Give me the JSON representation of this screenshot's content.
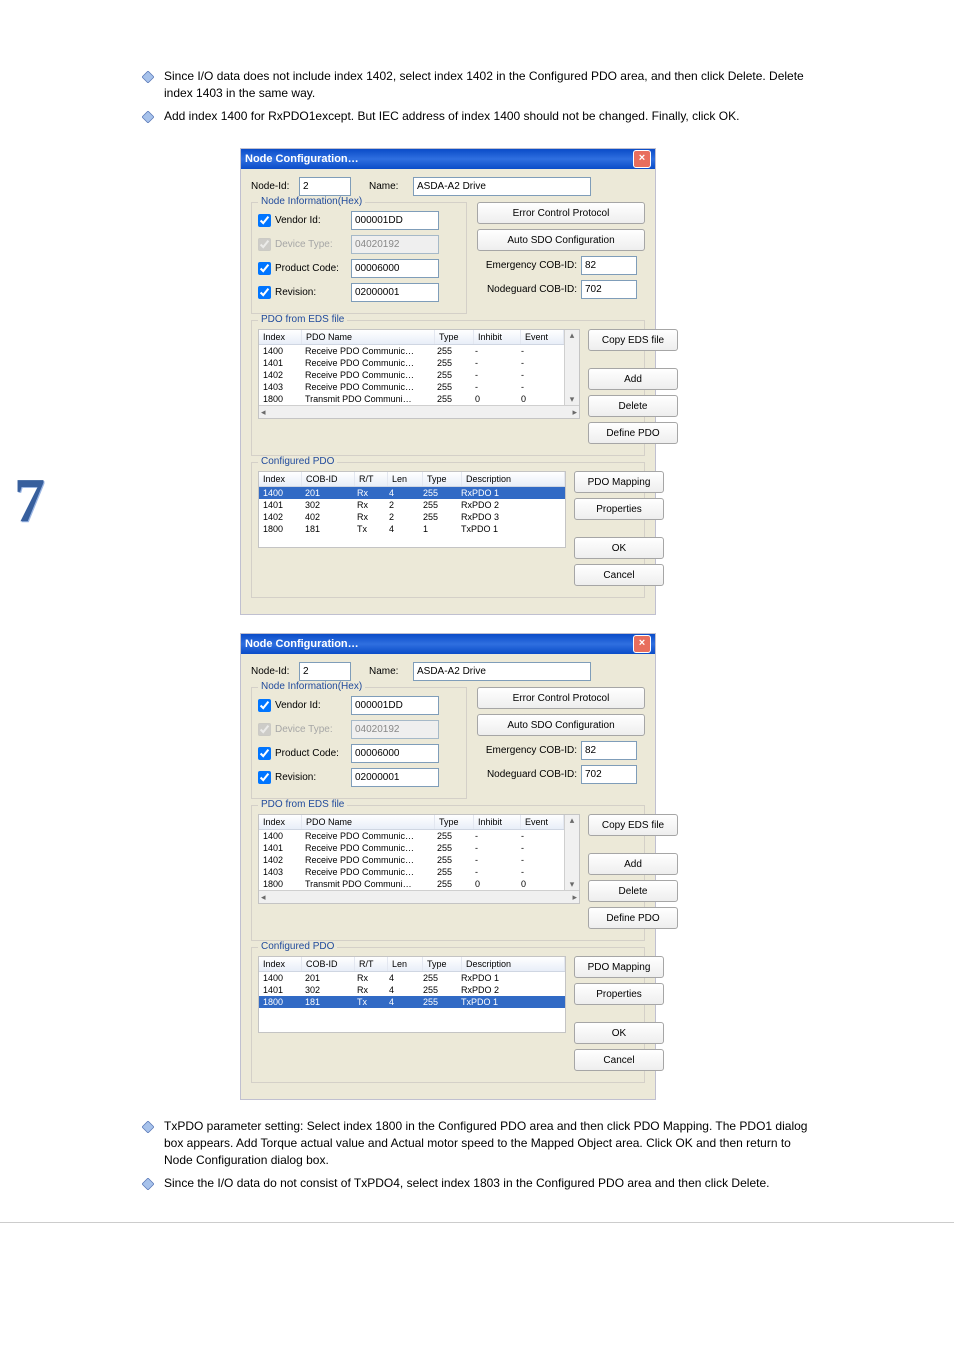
{
  "bullets": {
    "b1": "Since I/O data does not include index 1402, select index 1402 in the Configured PDO area, and then click Delete. Delete index 1403 in the same way.",
    "b2": "Add index 1400 for RxPDO1except. But IEC address of index 1400 should not be changed. Finally, click OK.",
    "b3": "TxPDO parameter setting: Select index 1800 in the Configured PDO area and then click PDO Mapping. The PDO1 dialog box appears. Add Torque actual value and Actual motor speed to the Mapped Object area. Click OK and then return to Node Configuration dialog box.",
    "b4": "Since the I/O data do not consist of TxPDO4, select index 1803 in the Configured PDO area and then click Delete."
  },
  "dlg1": {
    "title": "Node Configuration…",
    "nodeIdLabel": "Node-Id:",
    "nodeId": "2",
    "nameLabel": "Name:",
    "name": "ASDA-A2 Drive",
    "nodeInfoTitle": "Node Information(Hex)",
    "vendorLabel": "Vendor Id:",
    "vendorVal": "000001DD",
    "deviceTypeLabel": "Device Type:",
    "deviceTypeVal": "04020192",
    "productCodeLabel": "Product Code:",
    "productCodeVal": "00006000",
    "revisionLabel": "Revision:",
    "revisionVal": "02000001",
    "errBtn": "Error Control Protocol",
    "autoBtn": "Auto SDO Configuration",
    "emCobLabel": "Emergency COB-ID:",
    "emCobVal": "82",
    "ngCobLabel": "Nodeguard COB-ID:",
    "ngCobVal": "702",
    "pdoFromTitle": "PDO from EDS file",
    "pdoCols": [
      "Index",
      "PDO Name",
      "Type",
      "Inhibit",
      "Event"
    ],
    "pdoRows": [
      {
        "idx": "1400",
        "name": "Receive PDO Communic…",
        "type": "255",
        "inh": "-",
        "evt": "-"
      },
      {
        "idx": "1401",
        "name": "Receive PDO Communic…",
        "type": "255",
        "inh": "-",
        "evt": "-"
      },
      {
        "idx": "1402",
        "name": "Receive PDO Communic…",
        "type": "255",
        "inh": "-",
        "evt": "-"
      },
      {
        "idx": "1403",
        "name": "Receive PDO Communic…",
        "type": "255",
        "inh": "-",
        "evt": "-"
      },
      {
        "idx": "1800",
        "name": "Transmit PDO Communi…",
        "type": "255",
        "inh": "0",
        "evt": "0"
      }
    ],
    "copyBtn": "Copy EDS file",
    "addBtn": "Add",
    "delBtn": "Delete",
    "defBtn": "Define PDO",
    "cfgTitle": "Configured PDO",
    "cfgCols": [
      "Index",
      "COB-ID",
      "R/T",
      "Len",
      "Type",
      "Description"
    ],
    "cfgRows": [
      {
        "idx": "1400",
        "cob": "201",
        "rt": "Rx",
        "len": "4",
        "type": "255",
        "desc": "RxPDO 1",
        "sel": true
      },
      {
        "idx": "1401",
        "cob": "302",
        "rt": "Rx",
        "len": "2",
        "type": "255",
        "desc": "RxPDO 2"
      },
      {
        "idx": "1402",
        "cob": "402",
        "rt": "Rx",
        "len": "2",
        "type": "255",
        "desc": "RxPDO 3"
      },
      {
        "idx": "1800",
        "cob": "181",
        "rt": "Tx",
        "len": "4",
        "type": "1",
        "desc": "TxPDO 1"
      }
    ],
    "mapBtn": "PDO Mapping",
    "propBtn": "Properties",
    "okBtn": "OK",
    "cancelBtn": "Cancel"
  },
  "dlg2": {
    "title": "Node Configuration…",
    "nodeIdLabel": "Node-Id:",
    "nodeId": "2",
    "nameLabel": "Name:",
    "name": "ASDA-A2 Drive",
    "nodeInfoTitle": "Node Information(Hex)",
    "vendorLabel": "Vendor Id:",
    "vendorVal": "000001DD",
    "deviceTypeLabel": "Device Type:",
    "deviceTypeVal": "04020192",
    "productCodeLabel": "Product Code:",
    "productCodeVal": "00006000",
    "revisionLabel": "Revision:",
    "revisionVal": "02000001",
    "errBtn": "Error Control Protocol",
    "autoBtn": "Auto SDO Configuration",
    "emCobLabel": "Emergency COB-ID:",
    "emCobVal": "82",
    "ngCobLabel": "Nodeguard COB-ID:",
    "ngCobVal": "702",
    "pdoFromTitle": "PDO from EDS file",
    "pdoCols": [
      "Index",
      "PDO Name",
      "Type",
      "Inhibit",
      "Event"
    ],
    "pdoRows": [
      {
        "idx": "1400",
        "name": "Receive PDO Communic…",
        "type": "255",
        "inh": "-",
        "evt": "-"
      },
      {
        "idx": "1401",
        "name": "Receive PDO Communic…",
        "type": "255",
        "inh": "-",
        "evt": "-"
      },
      {
        "idx": "1402",
        "name": "Receive PDO Communic…",
        "type": "255",
        "inh": "-",
        "evt": "-"
      },
      {
        "idx": "1403",
        "name": "Receive PDO Communic…",
        "type": "255",
        "inh": "-",
        "evt": "-"
      },
      {
        "idx": "1800",
        "name": "Transmit PDO Communi…",
        "type": "255",
        "inh": "0",
        "evt": "0"
      }
    ],
    "copyBtn": "Copy EDS file",
    "addBtn": "Add",
    "delBtn": "Delete",
    "defBtn": "Define PDO",
    "cfgTitle": "Configured PDO",
    "cfgCols": [
      "Index",
      "COB-ID",
      "R/T",
      "Len",
      "Type",
      "Description"
    ],
    "cfgRows": [
      {
        "idx": "1400",
        "cob": "201",
        "rt": "Rx",
        "len": "4",
        "type": "255",
        "desc": "RxPDO 1"
      },
      {
        "idx": "1401",
        "cob": "302",
        "rt": "Rx",
        "len": "4",
        "type": "255",
        "desc": "RxPDO 2"
      },
      {
        "idx": "1800",
        "cob": "181",
        "rt": "Tx",
        "len": "4",
        "type": "255",
        "desc": "TxPDO 1",
        "sel": true
      }
    ],
    "mapBtn": "PDO Mapping",
    "propBtn": "Properties",
    "okBtn": "OK",
    "cancelBtn": "Cancel"
  }
}
